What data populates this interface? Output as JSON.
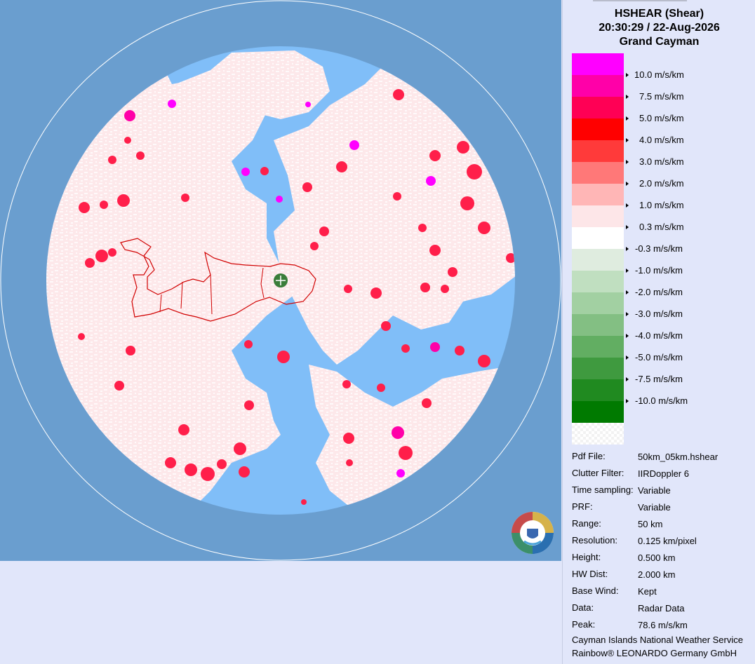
{
  "product": {
    "title": "HSHEAR (Shear)",
    "timestamp": "20:30:29 / 22-Aug-2026",
    "site": "Grand Cayman"
  },
  "colors": {
    "ocean": "#6a9ecf",
    "in_range_no_echo": "#80bef8",
    "panel_bg": "#e1e6fa",
    "coast": "#d10000",
    "radar_marker": "#3a7d3a"
  },
  "legend": {
    "entries": [
      {
        "label": "10.0 m/s/km",
        "color": "#ff00ff"
      },
      {
        "label": "7.5 m/s/km",
        "color": "#ff00a8"
      },
      {
        "label": "5.0 m/s/km",
        "color": "#ff0055"
      },
      {
        "label": "4.0 m/s/km",
        "color": "#ff0000"
      },
      {
        "label": "3.0 m/s/km",
        "color": "#ff3a3a"
      },
      {
        "label": "2.0 m/s/km",
        "color": "#ff7878"
      },
      {
        "label": "1.0 m/s/km",
        "color": "#ffb6b6"
      },
      {
        "label": "0.3 m/s/km",
        "color": "#fde6e8"
      },
      {
        "label": "-0.3 m/s/km",
        "color": "#ffffff"
      },
      {
        "label": "-1.0 m/s/km",
        "color": "#dfecdf"
      },
      {
        "label": "-2.0 m/s/km",
        "color": "#c0dfc0"
      },
      {
        "label": "-3.0 m/s/km",
        "color": "#a2d0a2"
      },
      {
        "label": "-4.0 m/s/km",
        "color": "#83bf83"
      },
      {
        "label": "-5.0 m/s/km",
        "color": "#62ae62"
      },
      {
        "label": "-7.5 m/s/km",
        "color": "#3f9a3f"
      },
      {
        "label": "-10.0 m/s/km",
        "color": "#208a20"
      },
      {
        "label": "",
        "color": "#007a00"
      }
    ],
    "nodata_pattern": "checkerboard"
  },
  "info": [
    {
      "key": "Pdf File:",
      "value": "50km_05km.hshear"
    },
    {
      "key": "Clutter Filter:",
      "value": "IIRDoppler 6"
    },
    {
      "key": "Time sampling:",
      "value": "Variable"
    },
    {
      "key": "PRF:",
      "value": "Variable"
    },
    {
      "key": "Range:",
      "value": "50 km"
    },
    {
      "key": "Resolution:",
      "value": "0.125 km/pixel"
    },
    {
      "key": "Height:",
      "value": "0.500 km"
    },
    {
      "key": "HW Dist:",
      "value": "2.000 km"
    },
    {
      "key": "Base Wind:",
      "value": "Kept"
    },
    {
      "key": "Data:",
      "value": "Radar Data"
    },
    {
      "key": "Peak:",
      "value": "78.6 m/s/km"
    }
  ],
  "footer": {
    "line1": "Cayman Islands National Weather Service",
    "line2": "Rainbow® LEONARDO Germany GmbH"
  },
  "map": {
    "radar_marker_icon": "crosshair-plus-icon",
    "logo_icon": "cayman-weather-service-logo"
  }
}
